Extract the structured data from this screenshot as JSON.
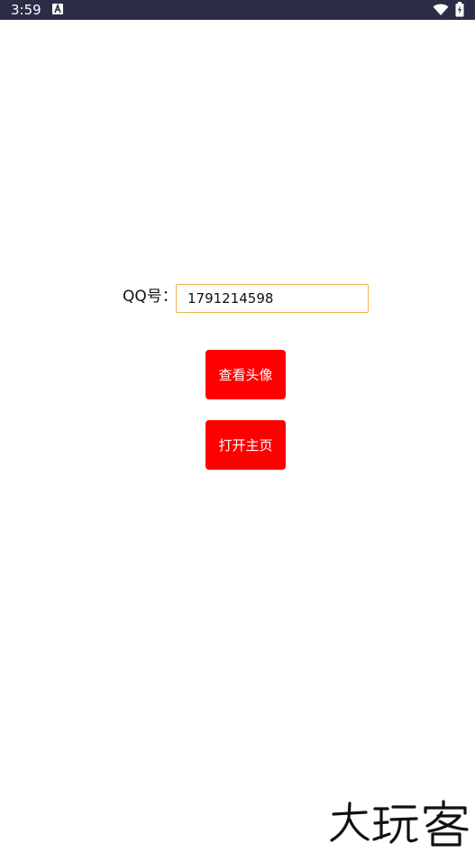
{
  "status_bar": {
    "time": "3:59",
    "app_icon": "a-icon",
    "wifi_icon": "wifi-icon",
    "battery_icon": "battery-charging-icon",
    "background": "#2b2d47"
  },
  "form": {
    "qq_label": "QQ号：",
    "qq_value": "1791214598",
    "input_border_color": "#f0b54c"
  },
  "buttons": {
    "view_avatar": "查看头像",
    "open_homepage": "打开主页",
    "color": "#fe0000"
  },
  "watermark": {
    "text": "大玩客"
  }
}
